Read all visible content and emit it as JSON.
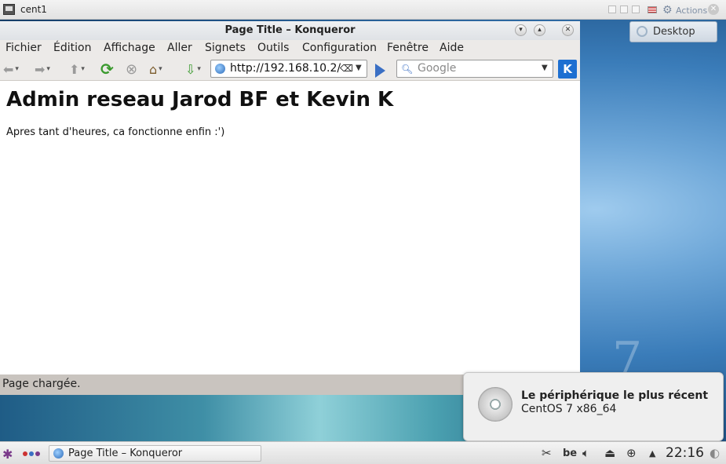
{
  "vm": {
    "title": "cent1",
    "actions_label": "Actions"
  },
  "desktop": {
    "button_label": "Desktop",
    "wallpaper_mark": "7"
  },
  "browser": {
    "window_title": "Page Title – Konqueror",
    "menu": [
      "Fichier",
      "Édition",
      "Affichage",
      "Aller",
      "Signets",
      "Outils",
      "Configuration",
      "Fenêtre",
      "Aide"
    ],
    "url": "http://192.168.10.2/",
    "search_placeholder": "Google",
    "kde_button": "K",
    "page": {
      "heading": "Admin reseau Jarod BF et Kevin K",
      "text": "Apres tant d'heures, ca fonctionne enfin :')"
    },
    "status": "Page chargée."
  },
  "notification": {
    "title": "Le périphérique le plus récent",
    "subtitle": "CentOS 7 x86_64"
  },
  "taskbar": {
    "task_label": "Page Title – Konqueror",
    "keyboard_layout": "be",
    "clock": "22:16"
  },
  "colors": {
    "accent": "#1d6fd1",
    "reload_green": "#3a9a2e",
    "status_bg": "#c9c4bf"
  }
}
